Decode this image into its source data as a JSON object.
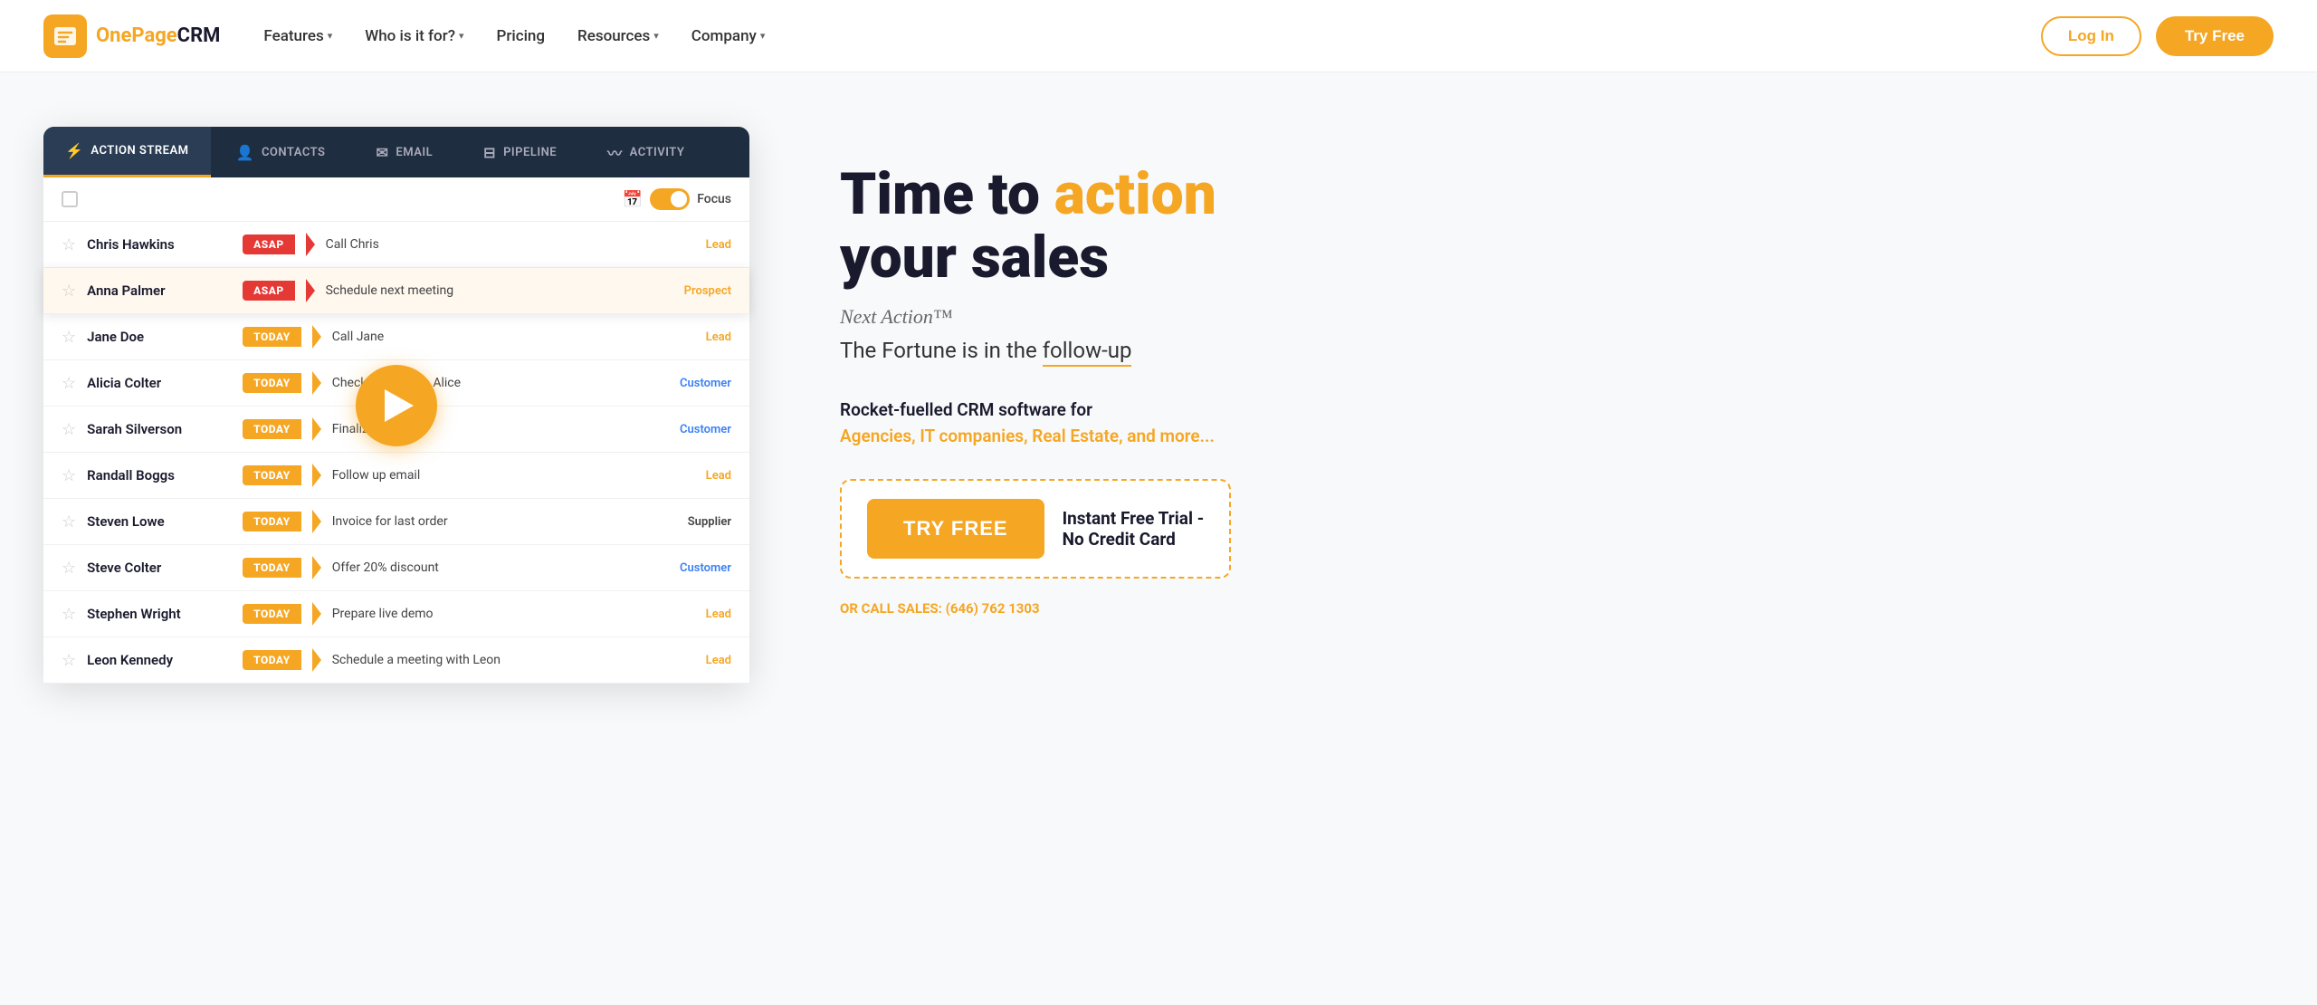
{
  "brand": {
    "name_part1": "OnePage",
    "name_part2": "CRM"
  },
  "nav": {
    "links": [
      {
        "label": "Features",
        "has_dropdown": true
      },
      {
        "label": "Who is it for?",
        "has_dropdown": true
      },
      {
        "label": "Pricing",
        "has_dropdown": false
      },
      {
        "label": "Resources",
        "has_dropdown": true
      },
      {
        "label": "Company",
        "has_dropdown": true
      }
    ],
    "login_label": "Log In",
    "try_free_label": "Try Free"
  },
  "crm": {
    "tabs": [
      {
        "key": "action_stream",
        "label": "ACTION STREAM",
        "icon": "⚡",
        "active": true
      },
      {
        "key": "contacts",
        "label": "CONTACTS",
        "icon": "👤"
      },
      {
        "key": "email",
        "label": "EMAIL",
        "icon": "✉"
      },
      {
        "key": "pipeline",
        "label": "PIPELINE",
        "icon": "▼"
      },
      {
        "key": "activity",
        "label": "ACTIVITY",
        "icon": "〰"
      }
    ],
    "focus_label": "Focus",
    "rows": [
      {
        "name": "Chris Hawkins",
        "tag": "ASAP",
        "tag_type": "asap",
        "action": "Call Chris",
        "type": "Lead",
        "type_class": "type-lead",
        "highlighted": false
      },
      {
        "name": "Anna Palmer",
        "tag": "ASAP",
        "tag_type": "asap",
        "action": "Schedule next meeting",
        "type": "Prospect",
        "type_class": "type-prospect",
        "highlighted": true
      },
      {
        "name": "Jane Doe",
        "tag": "TODAY",
        "tag_type": "today",
        "action": "Call Jane",
        "type": "Lead",
        "type_class": "type-lead",
        "highlighted": false
      },
      {
        "name": "Alicia Colter",
        "tag": "TODAY",
        "tag_type": "today",
        "action": "Check in call with Alice",
        "type": "Customer",
        "type_class": "type-customer",
        "highlighted": false
      },
      {
        "name": "Sarah Silverson",
        "tag": "TODAY",
        "tag_type": "today",
        "action": "Finalize proposal",
        "type": "Customer",
        "type_class": "type-customer",
        "highlighted": false
      },
      {
        "name": "Randall Boggs",
        "tag": "TODAY",
        "tag_type": "today",
        "action": "Follow up email",
        "type": "Lead",
        "type_class": "type-lead",
        "highlighted": false
      },
      {
        "name": "Steven Lowe",
        "tag": "TODAY",
        "tag_type": "today",
        "action": "Invoice for last order",
        "type": "Supplier",
        "type_class": "type-supplier",
        "highlighted": false
      },
      {
        "name": "Steve Colter",
        "tag": "TODAY",
        "tag_type": "today",
        "action": "Offer 20% discount",
        "type": "Customer",
        "type_class": "type-customer",
        "highlighted": false
      },
      {
        "name": "Stephen Wright",
        "tag": "TODAY",
        "tag_type": "today",
        "action": "Prepare live demo",
        "type": "Lead",
        "type_class": "type-lead",
        "highlighted": false
      },
      {
        "name": "Leon Kennedy",
        "tag": "TODAY",
        "tag_type": "today",
        "action": "Schedule a meeting with Leon",
        "type": "Lead",
        "type_class": "type-lead",
        "highlighted": false
      }
    ]
  },
  "hero": {
    "headline_part1": "Time to ",
    "headline_accent": "action",
    "headline_part2": "your sales",
    "next_action_label": "Next Action™",
    "subline_part1": "The Fortune is in the ",
    "subline_follow": "follow-up",
    "rocket_text": "Rocket-fuelled CRM software for",
    "rocket_types": "Agencies, IT companies, Real Estate, and more...",
    "try_free_label": "TRY FREE",
    "instant_text": "Instant Free Trial -\nNo Credit Card",
    "call_label": "OR CALL SALES:",
    "phone": "(646) 762 1303"
  }
}
